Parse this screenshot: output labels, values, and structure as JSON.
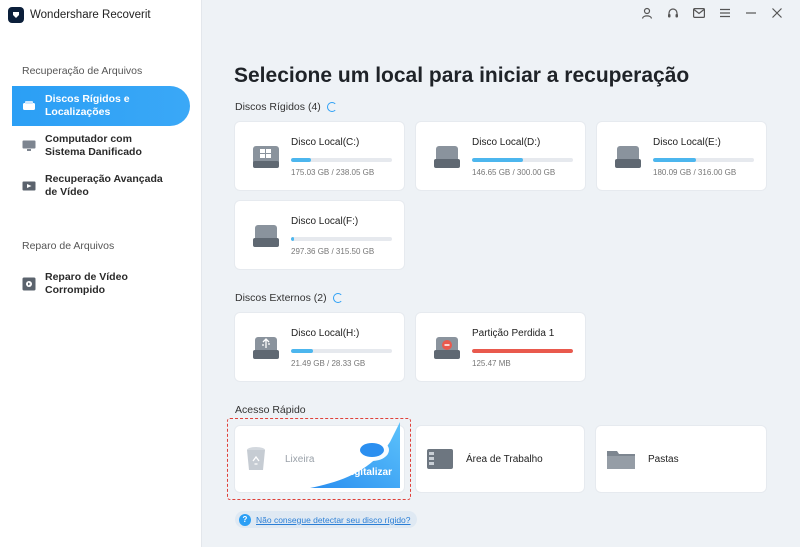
{
  "app": {
    "title": "Wondershare Recoverit"
  },
  "sidebar": {
    "section1": "Recuperação de Arquivos",
    "items": [
      {
        "label": "Discos Rígidos e Localizações",
        "icon": "hard-drive-icon",
        "active": true
      },
      {
        "label": "Computador com Sistema Danificado",
        "icon": "monitor-icon",
        "active": false
      },
      {
        "label": "Recuperação Avançada de Vídeo",
        "icon": "video-icon",
        "active": false
      }
    ],
    "section2": "Reparo de Arquivos",
    "repair_items": [
      {
        "label": "Reparo de Vídeo Corrompido",
        "icon": "video-repair-icon"
      }
    ]
  },
  "main": {
    "title": "Selecione um local para iniciar a recuperação",
    "hard_disks_title": "Discos Rígidos (4)",
    "hard_disks": [
      {
        "name": "Disco Local(C:)",
        "size": "175.03 GB / 238.05 GB",
        "usage": 0.2,
        "icon": "windows-drive-icon"
      },
      {
        "name": "Disco Local(D:)",
        "size": "146.65 GB / 300.00 GB",
        "usage": 0.5,
        "icon": "hard-drive-icon"
      },
      {
        "name": "Disco Local(E:)",
        "size": "180.09 GB / 316.00 GB",
        "usage": 0.43,
        "icon": "hard-drive-icon"
      },
      {
        "name": "Disco Local(F:)",
        "size": "297.36 GB / 315.50 GB",
        "usage": 0.03,
        "icon": "hard-drive-icon"
      }
    ],
    "external_title": "Discos Externos (2)",
    "external_disks": [
      {
        "name": "Disco Local(H:)",
        "size": "21.49 GB / 28.33 GB",
        "usage": 0.22,
        "icon": "usb-drive-icon"
      },
      {
        "name": "Partição Perdida 1",
        "size": "125.47 MB",
        "usage": 1.0,
        "icon": "lost-partition-icon"
      }
    ],
    "quick_title": "Acesso Rápido",
    "quick": {
      "trash": "Lixeira",
      "scan": "Digitalizar",
      "desktop": "Área de Trabalho",
      "folders": "Pastas"
    },
    "help_link": "Não consegue detectar seu disco rígido?"
  },
  "colors": {
    "accent": "#2b9ff5",
    "bar": "#4cb6ee",
    "lost": "#e9594d",
    "highlight": "#e0413a"
  }
}
